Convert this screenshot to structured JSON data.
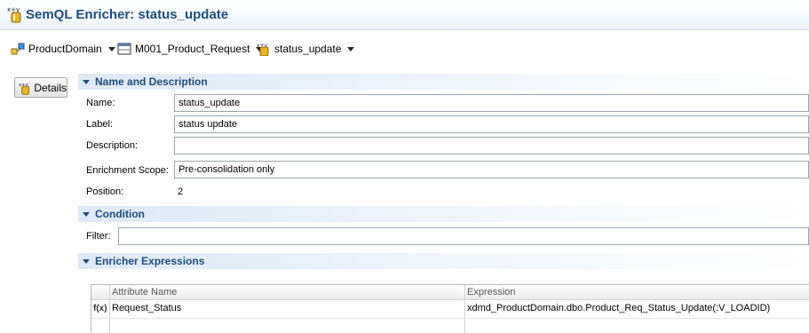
{
  "editor": {
    "title": "SemQL Enricher: status_update",
    "title_icon": "xy-expression-icon"
  },
  "breadcrumb": [
    {
      "label": "ProductDomain",
      "icon": "model-domain-icon"
    },
    {
      "label": "M001_Product_Request",
      "icon": "entity-table-icon"
    },
    {
      "label": "status_update",
      "icon": "xy-expression-icon"
    }
  ],
  "side_tabs": {
    "details_label": "Details"
  },
  "sections": {
    "name_description": {
      "title": "Name and Description",
      "name_label": "Name:",
      "name_value": "status_update",
      "label_label": "Label:",
      "label_value": "status update",
      "description_label": "Description:",
      "description_value": "",
      "scope_label": "Enrichment Scope:",
      "scope_value": "Pre-consolidation only",
      "position_label": "Position:",
      "position_value": "2"
    },
    "condition": {
      "title": "Condition",
      "filter_label": "Filter:",
      "filter_value": ""
    },
    "expressions": {
      "title": "Enricher Expressions",
      "columns": [
        "Attribute Name",
        "Expression"
      ],
      "rows": [
        {
          "marker": "f(x)",
          "attribute": "Request_Status",
          "expression": "xdmd_ProductDomain.dbo.Product_Req_Status_Update(:V_LOADID)"
        }
      ]
    }
  },
  "colors": {
    "accent": "#1f4d7a",
    "section_bg": "#dde9f5"
  }
}
